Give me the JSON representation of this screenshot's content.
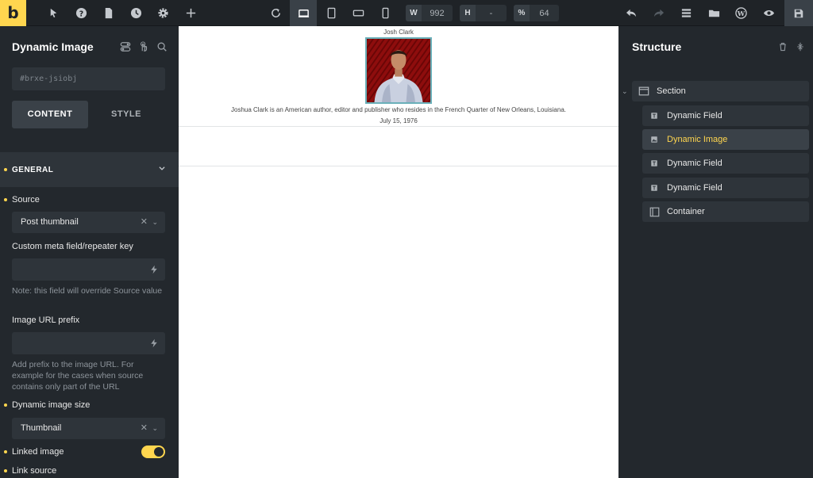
{
  "topbar": {
    "logo": "b",
    "width_label": "W",
    "width_value": "992",
    "height_label": "H",
    "height_value": "-",
    "zoom_label": "%",
    "zoom_value": "64"
  },
  "left_panel": {
    "title": "Dynamic Image",
    "element_id": "#brxe-jsiobj",
    "tabs": {
      "content": "CONTENT",
      "style": "STYLE"
    },
    "section_title": "GENERAL",
    "fields": {
      "source_label": "Source",
      "source_value": "Post thumbnail",
      "meta_label": "Custom meta field/repeater key",
      "meta_note": "Note: this field will override Source value",
      "prefix_label": "Image URL prefix",
      "prefix_note": "Add prefix to the image URL. For example for the cases when source contains only part of the URL",
      "size_label": "Dynamic image size",
      "size_value": "Thumbnail",
      "linked_label": "Linked image",
      "linked_on": true,
      "link_source_label": "Link source"
    },
    "accent_color": "#ffd64f"
  },
  "canvas": {
    "title": "Josh Clark",
    "description": "Joshua Clark is an American author, editor and publisher who resides in the French Quarter of New Orleans, Louisiana.",
    "date": "July 15, 1976"
  },
  "right_panel": {
    "title": "Structure",
    "tree": [
      {
        "label": "Section",
        "icon": "section-icon"
      },
      {
        "label": "Dynamic Field",
        "icon": "dynamic-field-icon"
      },
      {
        "label": "Dynamic Image",
        "icon": "dynamic-image-icon",
        "active": true
      },
      {
        "label": "Dynamic Field",
        "icon": "dynamic-field-icon"
      },
      {
        "label": "Dynamic Field",
        "icon": "dynamic-field-icon"
      },
      {
        "label": "Container",
        "icon": "container-icon"
      }
    ]
  }
}
